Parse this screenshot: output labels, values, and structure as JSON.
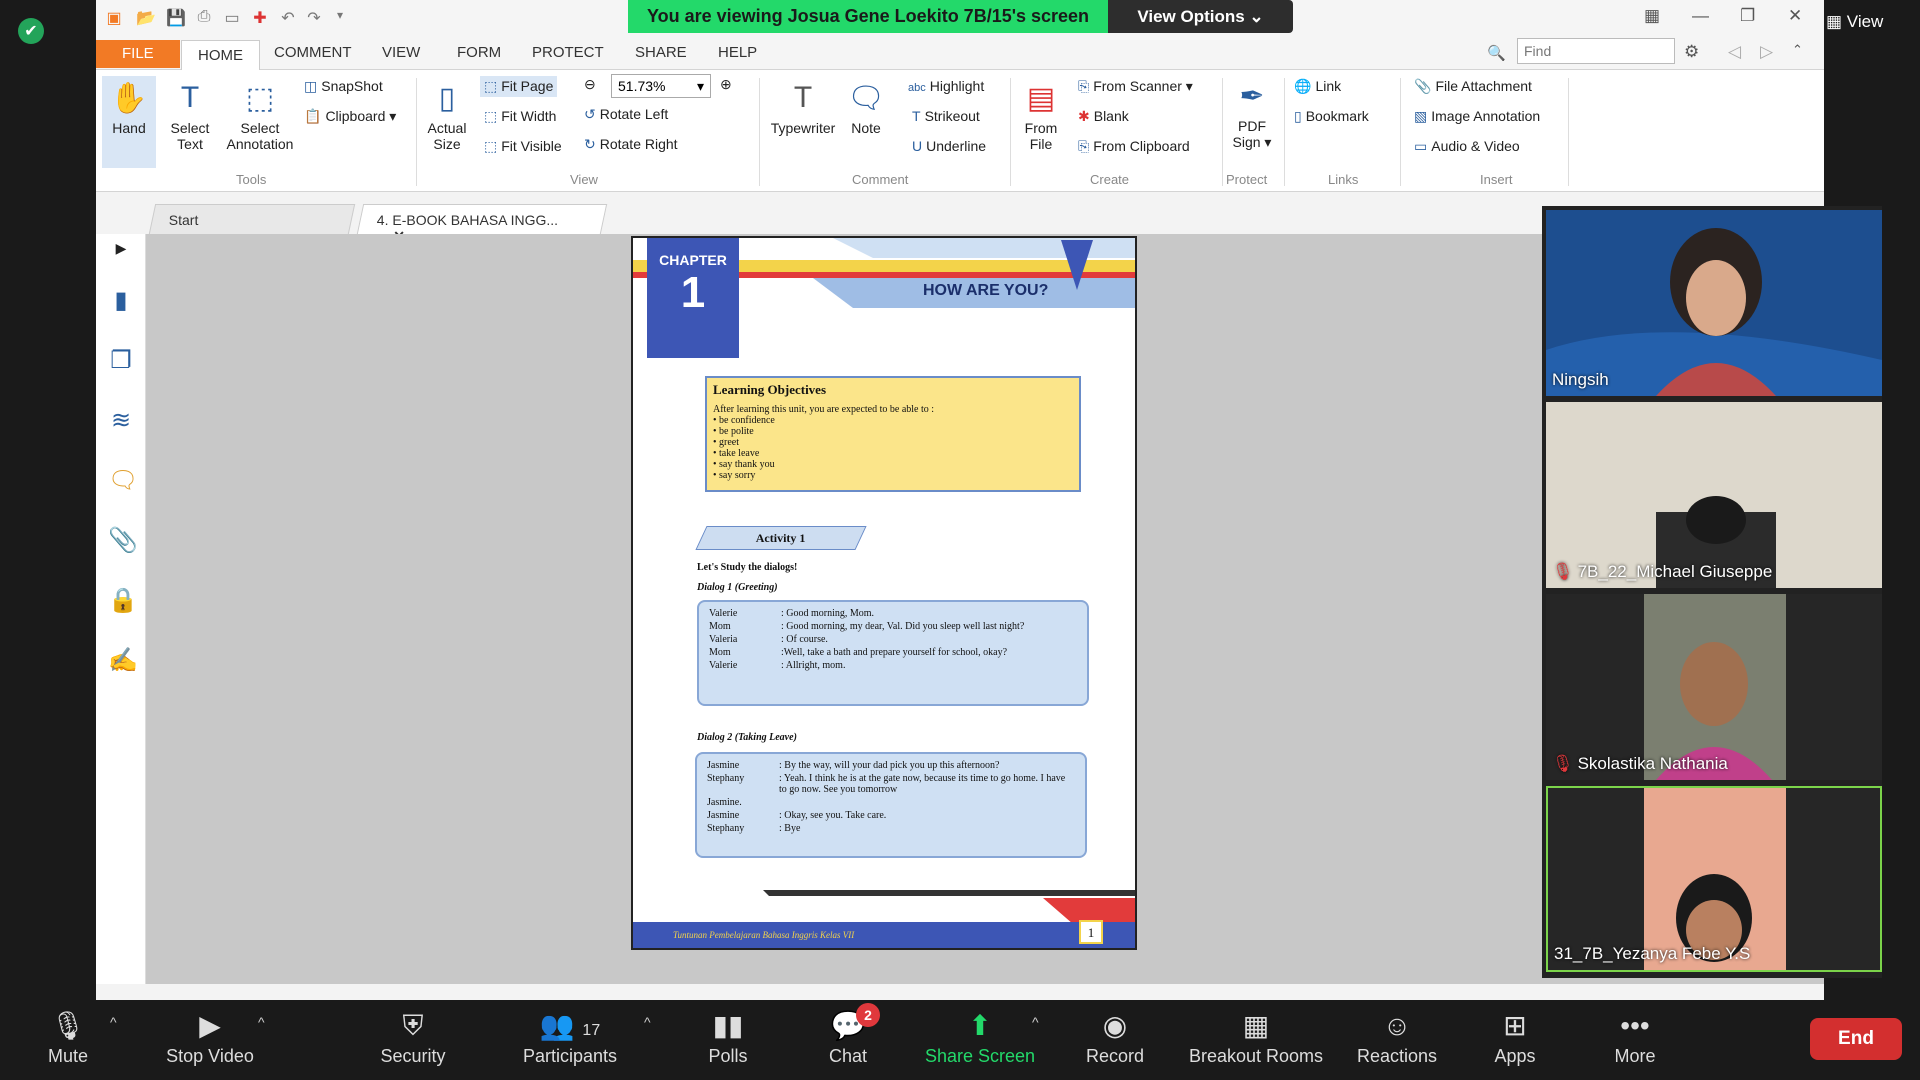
{
  "zoom": {
    "banner": "You are viewing Josua Gene Loekito 7B/15's screen",
    "view_options": "View Options",
    "view_label": "View",
    "toolbar": {
      "mute": "Mute",
      "stop_video": "Stop Video",
      "security": "Security",
      "participants": "Participants",
      "participants_count": "17",
      "polls": "Polls",
      "chat": "Chat",
      "chat_badge": "2",
      "share_screen": "Share Screen",
      "record": "Record",
      "breakout": "Breakout Rooms",
      "reactions": "Reactions",
      "apps": "Apps",
      "more": "More",
      "end": "End"
    },
    "accent_green": "#23d96a",
    "end_color": "#d32f2f"
  },
  "app": {
    "menu_tabs": [
      "FILE",
      "HOME",
      "COMMENT",
      "VIEW",
      "FORM",
      "PROTECT",
      "SHARE",
      "HELP"
    ],
    "find_placeholder": "Find",
    "tools": {
      "hand": "Hand",
      "select_text": [
        "Select",
        "Text"
      ],
      "select_annotation": [
        "Select",
        "Annotation"
      ],
      "snapshot": "SnapShot",
      "clipboard": "Clipboard",
      "group": "Tools"
    },
    "view": {
      "actual_size": [
        "Actual",
        "Size"
      ],
      "fit_page": "Fit Page",
      "fit_width": "Fit Width",
      "fit_visible": "Fit Visible",
      "zoom_value": "51.73%",
      "rotate_left": "Rotate Left",
      "rotate_right": "Rotate Right",
      "group": "View"
    },
    "comment": {
      "typewriter": "Typewriter",
      "note": "Note",
      "highlight": "Highlight",
      "strikeout": "Strikeout",
      "underline": "Underline",
      "group": "Comment"
    },
    "create": {
      "from_file": [
        "From",
        "File"
      ],
      "from_scanner": "From Scanner",
      "blank": "Blank",
      "from_clipboard": "From Clipboard",
      "group": "Create"
    },
    "protect": {
      "pdf_sign": [
        "PDF",
        "Sign"
      ],
      "group": "Protect"
    },
    "links": {
      "link": "Link",
      "bookmark": "Bookmark",
      "group": "Links"
    },
    "insert": {
      "file_attachment": "File Attachment",
      "image_annotation": "Image Annotation",
      "audio_video": "Audio & Video",
      "group": "Insert"
    },
    "doc_tabs": [
      "Start",
      "4. E-BOOK BAHASA INGG..."
    ]
  },
  "pdf": {
    "chapter_label": "CHAPTER",
    "chapter_number": "1",
    "title": "HOW ARE YOU?",
    "lo_title": "Learning Objectives",
    "lo_intro": "After learning this unit, you are expected to be able to :",
    "lo_items": [
      "be confidence",
      "be polite",
      "greet",
      "take leave",
      "say thank you",
      "say sorry"
    ],
    "activity": "Activity 1",
    "study": "Let's Study the dialogs!",
    "dialog1_title": "Dialog 1 (Greeting)",
    "dialog1": [
      {
        "speaker": "Valerie",
        "line": ": Good morning, Mom."
      },
      {
        "speaker": "Mom",
        "line": ": Good morning, my dear, Val. Did you sleep well last night?"
      },
      {
        "speaker": "Valeria",
        "line": ": Of course."
      },
      {
        "speaker": "Mom",
        "line": ":Well, take a bath and prepare yourself for school, okay?"
      },
      {
        "speaker": "Valerie",
        "line": ": Allright, mom."
      }
    ],
    "dialog2_title": "Dialog 2 (Taking Leave)",
    "dialog2": [
      {
        "speaker": "Jasmine",
        "line": ": By the way, will your dad pick you up this afternoon?"
      },
      {
        "speaker": "Stephany",
        "line": ": Yeah. I think he is at the gate now, because its time to go home. I have to go now. See you tomorrow"
      },
      {
        "speaker": "Jasmine.",
        "line": ""
      },
      {
        "speaker": "Jasmine",
        "line": ": Okay, see you. Take care."
      },
      {
        "speaker": "Stephany",
        "line": ": Bye"
      }
    ],
    "footer": "Tuntunan Pembelajaran Bahasa Inggris Kelas VII",
    "page_number": "1"
  },
  "participants": [
    {
      "name": "Ningsih",
      "muted": false
    },
    {
      "name": "7B_22_Michael Giuseppe",
      "muted": true
    },
    {
      "name": "Skolastika Nathania",
      "muted": true
    },
    {
      "name": "31_7B_Yezanya Febe Y.S",
      "muted": false
    }
  ]
}
